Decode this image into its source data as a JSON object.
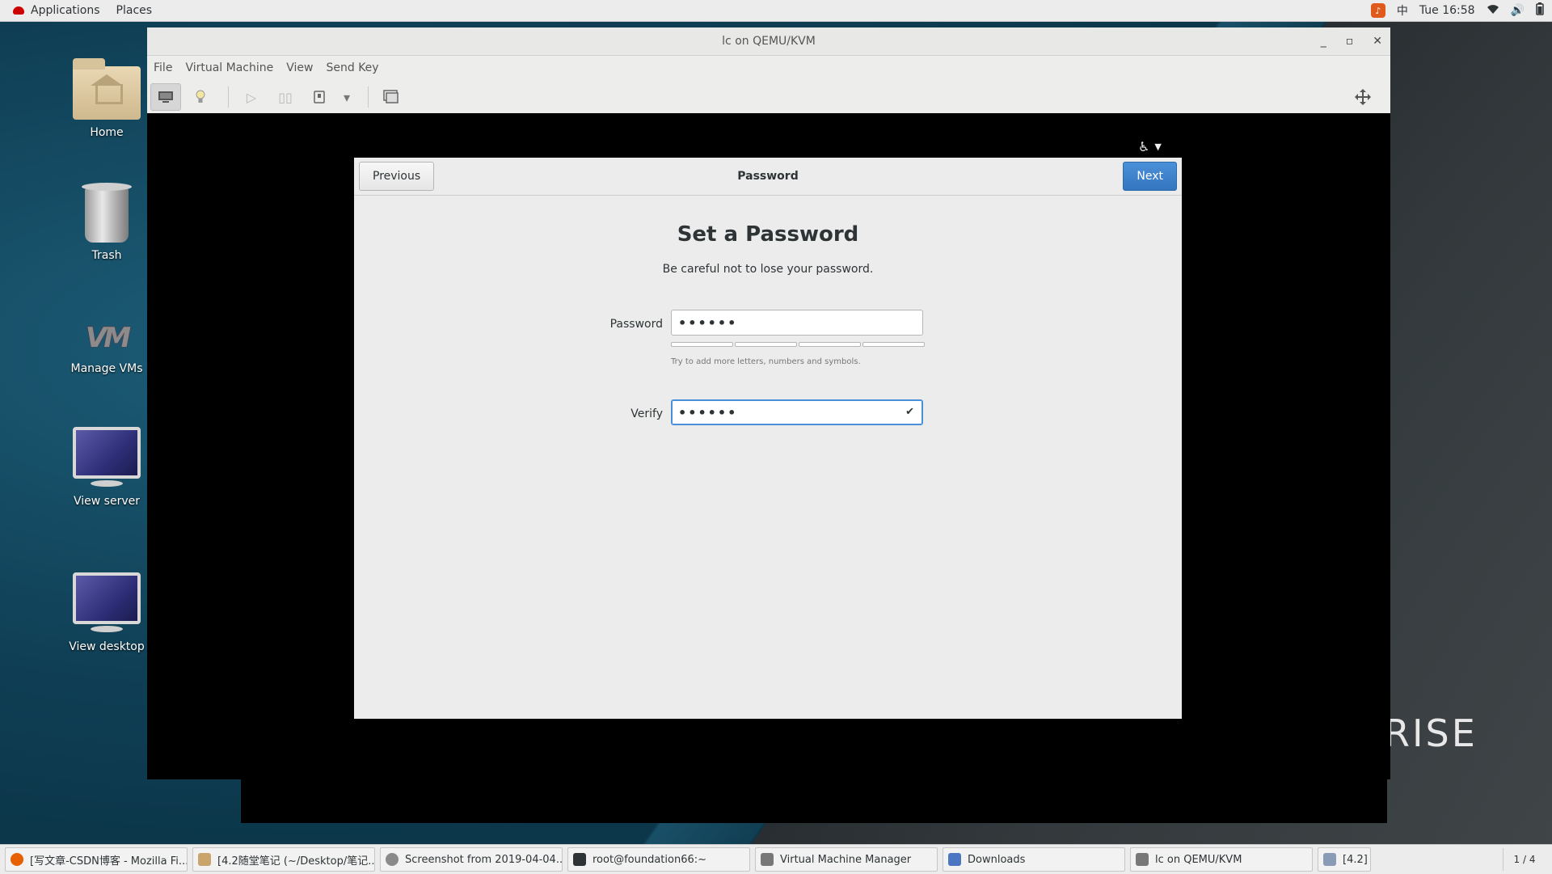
{
  "top_bar": {
    "applications": "Applications",
    "places": "Places",
    "input_method": "中",
    "clock": "Tue 16:58",
    "icons": [
      "notification-icon",
      "wifi-icon",
      "volume-icon",
      "battery-icon"
    ]
  },
  "desktop": {
    "icons": [
      {
        "label": "Home",
        "icon": "home-folder-icon"
      },
      {
        "label": "Trash",
        "icon": "trash-icon"
      },
      {
        "label": "Manage VMs",
        "icon": "virt-manager-icon"
      },
      {
        "label": "View server",
        "icon": "monitor-icon"
      },
      {
        "label": "View desktop",
        "icon": "monitor-icon"
      }
    ],
    "wallpaper_text": "RISE"
  },
  "vm_window": {
    "title": "lc on QEMU/KVM",
    "controls": {
      "minimize": "_",
      "maximize": "▫",
      "close": "✕"
    },
    "menu": [
      "File",
      "Virtual Machine",
      "View",
      "Send Key"
    ],
    "toolbar_icons": [
      "console-icon",
      "details-bulb-icon",
      "run-icon",
      "pause-icon",
      "shutdown-icon",
      "dropdown-icon",
      "snapshots-icon",
      "fullscreen-icon"
    ]
  },
  "installer": {
    "header_title": "Password",
    "previous_label": "Previous",
    "next_label": "Next",
    "heading": "Set a Password",
    "subtitle": "Be careful not to lose your password.",
    "password_label": "Password",
    "password_value": "••••••",
    "strength_hint": "Try to add more letters, numbers and symbols.",
    "verify_label": "Verify",
    "verify_value": "••••••",
    "accessibility_icon": "accessibility-icon"
  },
  "taskbar": {
    "tasks": [
      {
        "label": "[写文章-CSDN博客 - Mozilla Fi...",
        "icon": "firefox-icon",
        "color": "#e66000"
      },
      {
        "label": "[4.2随堂笔记 (~/Desktop/笔记...",
        "icon": "text-editor-icon",
        "color": "#c9a56b"
      },
      {
        "label": "Screenshot from 2019-04-04...",
        "icon": "screenshot-icon",
        "color": "#8a8a8a"
      },
      {
        "label": "root@foundation66:~",
        "icon": "terminal-icon",
        "color": "#2e3436"
      },
      {
        "label": "Virtual Machine Manager",
        "icon": "virt-manager-icon",
        "color": "#777777"
      },
      {
        "label": "Downloads",
        "icon": "folder-icon",
        "color": "#4a76c2"
      },
      {
        "label": "lc on QEMU/KVM",
        "icon": "virt-manager-icon",
        "color": "#777777"
      },
      {
        "label": "[4.2]",
        "icon": "document-icon",
        "color": "#8a9bb8"
      }
    ],
    "workspace": "1 / 4"
  }
}
